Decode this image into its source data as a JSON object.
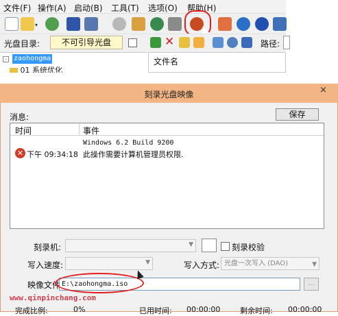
{
  "menu": {
    "items": [
      "文件(F)",
      "操作(A)",
      "启动(B)",
      "工具(T)",
      "选项(O)",
      "帮助(H)"
    ]
  },
  "toolbar2": {
    "cd_dir_label": "光盘目录:",
    "boot_type": "不可引导光盘",
    "path_label": "路径:"
  },
  "tree": {
    "selected_node": "zaohongma",
    "child_node": "01 系统优化"
  },
  "filelist": {
    "column_name": "文件名"
  },
  "dialog": {
    "title": "刻录光盘映像",
    "close_glyph": "×",
    "messages_label": "消息:",
    "save_button": "保存",
    "columns": {
      "time": "时间",
      "event": "事件"
    },
    "log": [
      {
        "time": "",
        "event": "Windows 6.2 Build 9200"
      },
      {
        "time": "下午 09:34:18",
        "event": "此操作需要计算机管理员权限."
      }
    ],
    "burner_label": "刻录机:",
    "verify_label": "刻录校验",
    "speed_label": "写入速度:",
    "write_mode_label": "写入方式:",
    "write_mode_value": "光盘一次写入 (DAO)",
    "image_file_label": "映像文件:",
    "image_file_value": "E:\\zaohongma.iso",
    "browse_button": "...",
    "status": {
      "ratio_label": "完成比例:",
      "ratio_value": "0%",
      "elapsed_label": "已用时间:",
      "elapsed_value": "00:00:00",
      "remaining_label": "剩余时间:",
      "remaining_value": "00:00:00"
    }
  },
  "watermark": "www.qinpinchang.com",
  "colors": {
    "accent_red": "#e0201e",
    "title_bar": "#f3b583",
    "error_red": "#d03a26"
  }
}
